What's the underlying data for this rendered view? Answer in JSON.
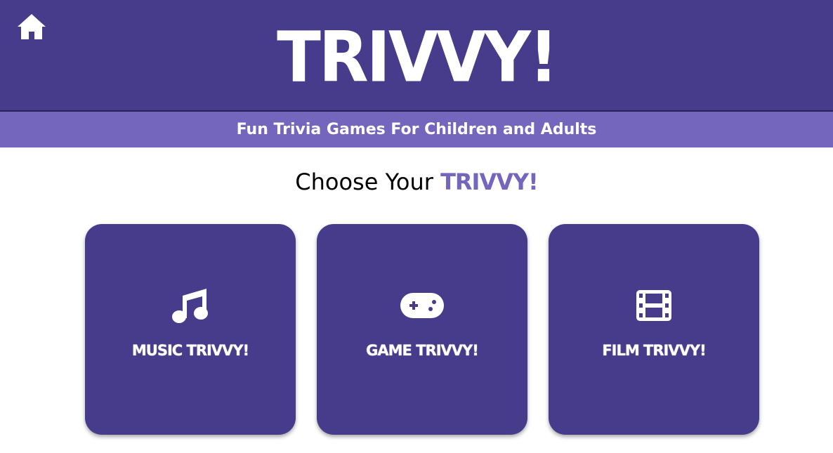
{
  "header": {
    "logo_text": "TRIVVY!",
    "home_icon": "home-icon",
    "background_color": "#473b8b"
  },
  "subheader": {
    "tagline": "Fun Trivia Games For Children and Adults",
    "background_color": "#7466bd"
  },
  "main": {
    "heading_prefix": "Choose Your ",
    "heading_brand": "TRIVVY!",
    "cards": [
      {
        "label": "MUSIC TRIVVY!",
        "icon": "music-note-icon"
      },
      {
        "label": "GAME TRIVVY!",
        "icon": "gamepad-icon"
      },
      {
        "label": "FILM TRIVVY!",
        "icon": "film-icon"
      }
    ]
  },
  "colors": {
    "primary": "#473b8b",
    "accent": "#7466bd",
    "text_on_primary": "#ffffff"
  }
}
